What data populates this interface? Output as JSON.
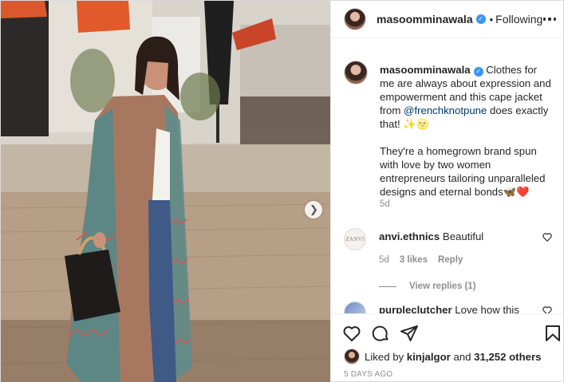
{
  "header": {
    "username": "masoomminawala",
    "separator": "•",
    "follow_status": "Following"
  },
  "caption": {
    "username": "masoomminawala",
    "text_before_mention": "Clothes for me are always about expression and empowerment and this cape jacket from",
    "mention": "@frenchknotpune",
    "text_after_mention": "does exactly that! ✨🌝",
    "paragraph2": "They're a homegrown brand spun with love by two women entrepreneurs tailoring unparalleled designs and eternal bonds🦋❤️",
    "time": "5d"
  },
  "comments": [
    {
      "avatar_text": "ZANVI",
      "username": "anvi.ethnics",
      "text": "Beautiful",
      "time": "5d",
      "likes": "3 likes",
      "reply_label": "Reply",
      "view_replies": "View replies (1)"
    },
    {
      "username": "purpleclutcher",
      "text": "Love how this"
    }
  ],
  "likes": {
    "prefix": "Liked by",
    "user": "kinjalgor",
    "conjunction": "and",
    "others": "31,252 others"
  },
  "post_date": "5 DAYS AGO",
  "icons": {
    "verified": "verified-badge",
    "more": "more-horizontal-icon",
    "like": "heart-icon",
    "comment": "comment-icon",
    "share": "paper-plane-icon",
    "save": "bookmark-icon",
    "next": "chevron-right-icon"
  },
  "colors": {
    "verified": "#3897f0",
    "mention": "#00376b",
    "muted": "#8e8e8e",
    "text": "#262626"
  }
}
